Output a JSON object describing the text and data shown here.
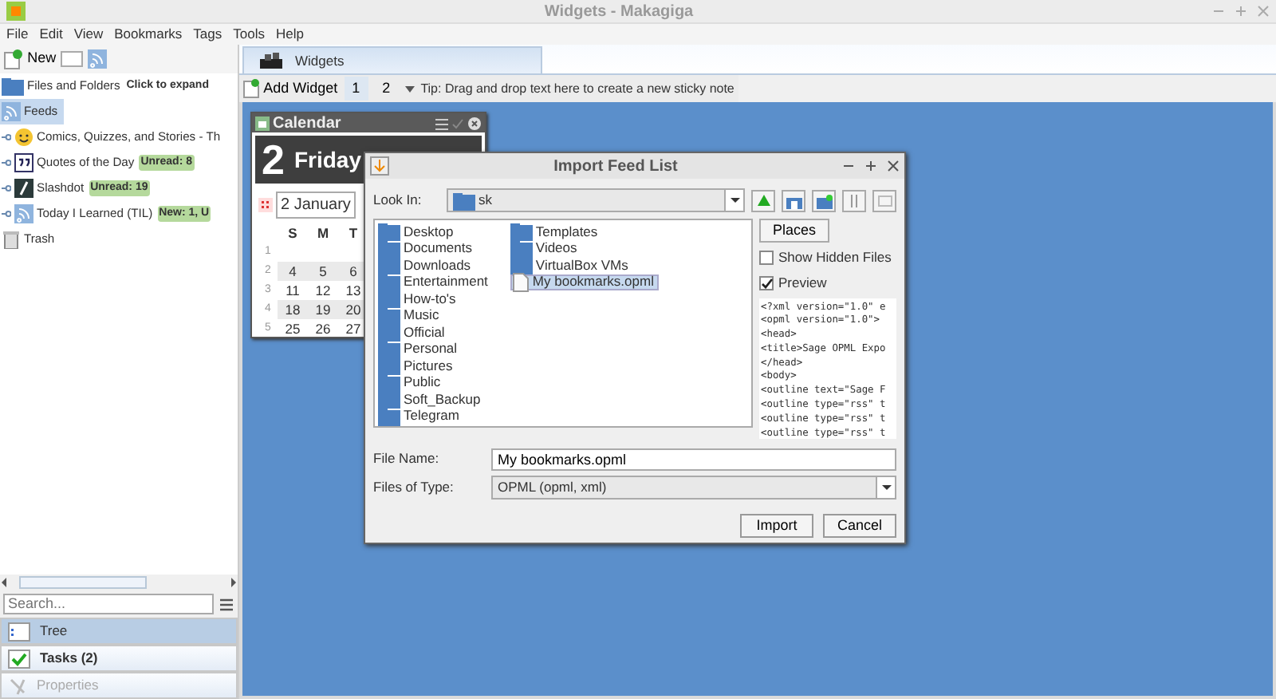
{
  "window": {
    "title": "Widgets - Makagiga"
  },
  "menu": [
    "File",
    "Edit",
    "View",
    "Bookmarks",
    "Tags",
    "Tools",
    "Help"
  ],
  "sidebar": {
    "new_label": "New",
    "tree": [
      {
        "label": "Files and Folders",
        "selected": false,
        "badge": {
          "text": "Click to expand",
          "color": "#ffffff"
        }
      },
      {
        "label": "Feeds",
        "selected": true,
        "children": [
          {
            "label": "Comics, Quizzes, and Stories - Th",
            "selected": false
          },
          {
            "label": "Quotes of the Day",
            "selected": false,
            "badge": {
              "text": "Unread: 8",
              "color": "#b5d99c"
            }
          },
          {
            "label": "Slashdot",
            "selected": false,
            "badge": {
              "text": "Unread: 19",
              "color": "#b5d99c"
            }
          },
          {
            "label": "Today I Learned (TIL)",
            "selected": false,
            "badge": {
              "text": "New: 1, U",
              "color": "#b5d99c"
            }
          }
        ]
      },
      {
        "label": "Trash",
        "selected": false
      }
    ],
    "search": {
      "placeholder": "Search..."
    },
    "bottom_tabs": [
      {
        "label": "Tree",
        "selected": true,
        "emphasized": false,
        "disabled": false
      },
      {
        "label": "Tasks (2)",
        "selected": false,
        "emphasized": true,
        "disabled": false
      },
      {
        "label": "Properties",
        "selected": false,
        "emphasized": false,
        "disabled": true
      }
    ]
  },
  "tabs": [
    {
      "label": "Widgets",
      "selected": true
    }
  ],
  "widget_toolbar": {
    "add_label": "Add Widget",
    "pages": [
      {
        "label": "1",
        "selected": true
      },
      {
        "label": "2",
        "selected": false
      }
    ],
    "tip": "Tip: Drag and drop text here to create a new sticky note"
  },
  "calendar": {
    "title": "Calendar",
    "day": "2",
    "weekday": "Friday",
    "date_field": "2 January",
    "weekdays": [
      "S",
      "M",
      "T"
    ],
    "weeks": [
      {
        "number": "1"
      },
      {
        "number": "2",
        "days": [
          "4",
          "5",
          "6"
        ]
      },
      {
        "number": "3",
        "days": [
          "11",
          "12",
          "13"
        ]
      },
      {
        "number": "4",
        "days": [
          "18",
          "19",
          "20"
        ]
      },
      {
        "number": "5",
        "days": [
          "25",
          "26",
          "27"
        ]
      }
    ]
  },
  "dialog": {
    "title": "Import Feed List",
    "look_in_label": "Look In:",
    "look_in_value": "sk",
    "files": [
      {
        "name": "Desktop",
        "kind": "folder",
        "selected": false
      },
      {
        "name": "Documents",
        "kind": "folder",
        "selected": false
      },
      {
        "name": "Downloads",
        "kind": "folder",
        "selected": false
      },
      {
        "name": "Entertainment",
        "kind": "folder",
        "selected": false
      },
      {
        "name": "How-to's",
        "kind": "folder",
        "selected": false
      },
      {
        "name": "Music",
        "kind": "folder",
        "selected": false
      },
      {
        "name": "Official",
        "kind": "folder",
        "selected": false
      },
      {
        "name": "Personal",
        "kind": "folder",
        "selected": false
      },
      {
        "name": "Pictures",
        "kind": "folder",
        "selected": false
      },
      {
        "name": "Public",
        "kind": "folder",
        "selected": false
      },
      {
        "name": "Soft_Backup",
        "kind": "folder",
        "selected": false
      },
      {
        "name": "Telegram",
        "kind": "folder",
        "selected": false
      },
      {
        "name": "Templates",
        "kind": "folder",
        "selected": false
      },
      {
        "name": "Videos",
        "kind": "folder",
        "selected": false
      },
      {
        "name": "VirtualBox VMs",
        "kind": "folder",
        "selected": false
      },
      {
        "name": "My bookmarks.opml",
        "kind": "file",
        "selected": true
      }
    ],
    "places_label": "Places",
    "show_hidden": {
      "label": "Show Hidden Files",
      "checked": false
    },
    "preview": {
      "label": "Preview",
      "checked": true
    },
    "preview_lines": [
      "<?xml version=\"1.0\" e",
      "<opml version=\"1.0\">",
      "<head>",
      "<title>Sage OPML Expo",
      "</head>",
      "<body>",
      "<outline text=\"Sage F",
      "<outline type=\"rss\" t",
      "<outline type=\"rss\" t",
      "<outline type=\"rss\" t"
    ],
    "file_name_label": "File Name:",
    "file_name": "My bookmarks.opml",
    "file_type_label": "Files of Type:",
    "file_type": "OPML (opml, xml)",
    "buttons": [
      "Import",
      "Cancel"
    ]
  }
}
